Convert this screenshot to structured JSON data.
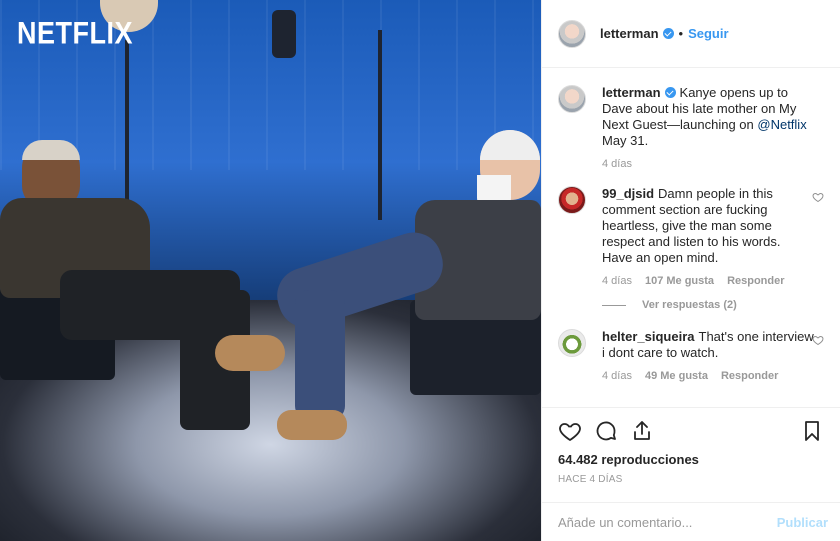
{
  "media": {
    "brand_text": "NETFLIX"
  },
  "post": {
    "author": "letterman",
    "follow_label": "Seguir",
    "separator": "•",
    "caption_prefix": "Kanye opens up to Dave about his late mother on My Next Guest—launching on ",
    "caption_mention": "@Netflix",
    "caption_suffix": " May 31.",
    "caption_age": "4 días"
  },
  "comments": [
    {
      "user": "99_djsid",
      "text": "Damn people in this comment section are fucking heartless, give the man some respect and listen to his words. Have an open mind.",
      "age": "4 días",
      "likes": "107 Me gusta",
      "reply_label": "Responder"
    },
    {
      "user": "helter_siqueira",
      "text": "That's one interview i dont care to watch.",
      "age": "4 días",
      "likes": "49 Me gusta",
      "reply_label": "Responder"
    }
  ],
  "view_replies_label": "Ver respuestas (2)",
  "stats": {
    "views": "64.482 reproducciones",
    "time_ago": "HACE 4 DÍAS"
  },
  "composer": {
    "placeholder": "Añade un comentario...",
    "publish_label": "Publicar"
  },
  "colors": {
    "accent": "#3897f0",
    "publish_disabled": "#b2dffc",
    "muted": "#999999"
  },
  "icons": [
    "verified-icon",
    "heart-icon",
    "comment-icon",
    "share-icon",
    "bookmark-icon"
  ]
}
